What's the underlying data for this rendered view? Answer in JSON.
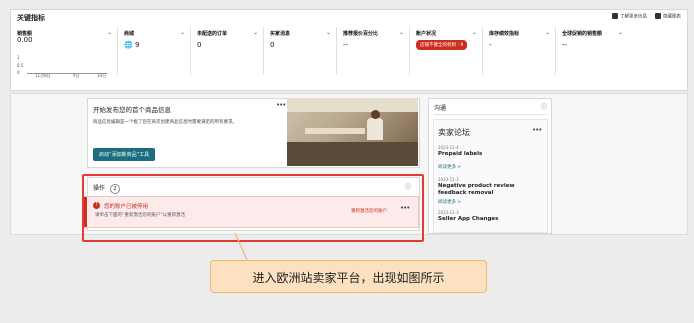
{
  "panel": {
    "title": "关键指标",
    "actions": [
      {
        "label": "了解更多信息",
        "icon": "gift-icon"
      },
      {
        "label": "隐藏图表",
        "icon": "chart-hide-icon"
      }
    ],
    "metrics": [
      {
        "label": "销售额",
        "value": "0.00"
      },
      {
        "label": "商城",
        "value": "9",
        "icon": "globe-icon"
      },
      {
        "label": "未配送的订单",
        "value": "0"
      },
      {
        "label": "买家消息",
        "value": "0"
      },
      {
        "label": "推荐报价百分比",
        "value": "--"
      },
      {
        "label": "账户状况",
        "badge": "店铺不健全的机制",
        "badge_count": "9"
      },
      {
        "label": "库存绩效指标",
        "value": "-"
      },
      {
        "label": "全球促销的销售额",
        "value": "--"
      }
    ],
    "sales_chart": {
      "y_ticks": [
        "1",
        "0.5",
        "0"
      ],
      "x_ticks": [
        "11月8日",
        "9日",
        "14日"
      ]
    }
  },
  "promo": {
    "title": "开始发布您的首个商品信息",
    "description": "商品信息编辑是一个框了您在商次创建商品信息时需要满足的所有要求。",
    "button": "启动“添加新商品”工具"
  },
  "forum_panel": {
    "header": "沟通",
    "title": "卖家论坛",
    "posts": [
      {
        "date": "2023-11-4",
        "title": "Prepaid labels",
        "link": "阅读更多 >"
      },
      {
        "date": "2023-11-3",
        "title": "Negative product review feedback removal",
        "link": "阅读更多 >"
      },
      {
        "date": "2023-11-3",
        "title": "Seller App Changes",
        "link": ""
      }
    ]
  },
  "actions_section": {
    "title": "操作",
    "count": "2",
    "alert": {
      "title": "您的账户已被停用",
      "body": "请单击下面的“重新激活您的账户”以重新激活",
      "link": "重新激活您的账户"
    }
  },
  "callout": {
    "text": "进入欧洲站卖家平台，出现如图所示"
  },
  "colors": {
    "accent_teal": "#1a6e7e",
    "alert_red": "#cc2e1d",
    "highlight_border": "#e53935",
    "callout_bg": "#fbe1bf"
  }
}
